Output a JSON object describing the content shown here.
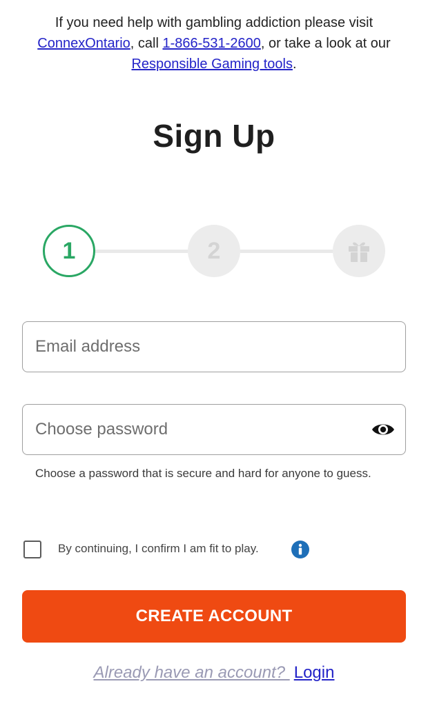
{
  "notice": {
    "text_before": "If you need help with gambling addiction please visit ",
    "link_connex": "ConnexOntario",
    "text_call": ", call ",
    "link_phone": "1-866-531-2600",
    "text_look": ", or take a look at our ",
    "link_tools": "Responsible Gaming tools",
    "text_end": "."
  },
  "page_title": "Sign Up",
  "stepper": {
    "steps": [
      {
        "label": "1",
        "state": "active"
      },
      {
        "label": "2",
        "state": "inactive"
      },
      {
        "icon": "gift-icon",
        "state": "inactive"
      }
    ],
    "active_color": "#2aa764"
  },
  "form": {
    "email": {
      "placeholder": "Email address",
      "value": ""
    },
    "password": {
      "placeholder": "Choose password",
      "value": "",
      "toggle_icon": "eye-icon"
    },
    "password_hint": "Choose a password that is secure and hard for anyone to guess.",
    "confirm_checkbox": {
      "label": "By continuing, I confirm I am fit to play.",
      "checked": false,
      "info_icon": "info-icon"
    },
    "submit_label": "CREATE ACCOUNT"
  },
  "login": {
    "prompt": "Already have an account? ",
    "link": "Login"
  },
  "colors": {
    "accent": "#ef4a12",
    "step_active": "#2aa764",
    "link": "#2323c8",
    "info": "#1e6fb8"
  }
}
